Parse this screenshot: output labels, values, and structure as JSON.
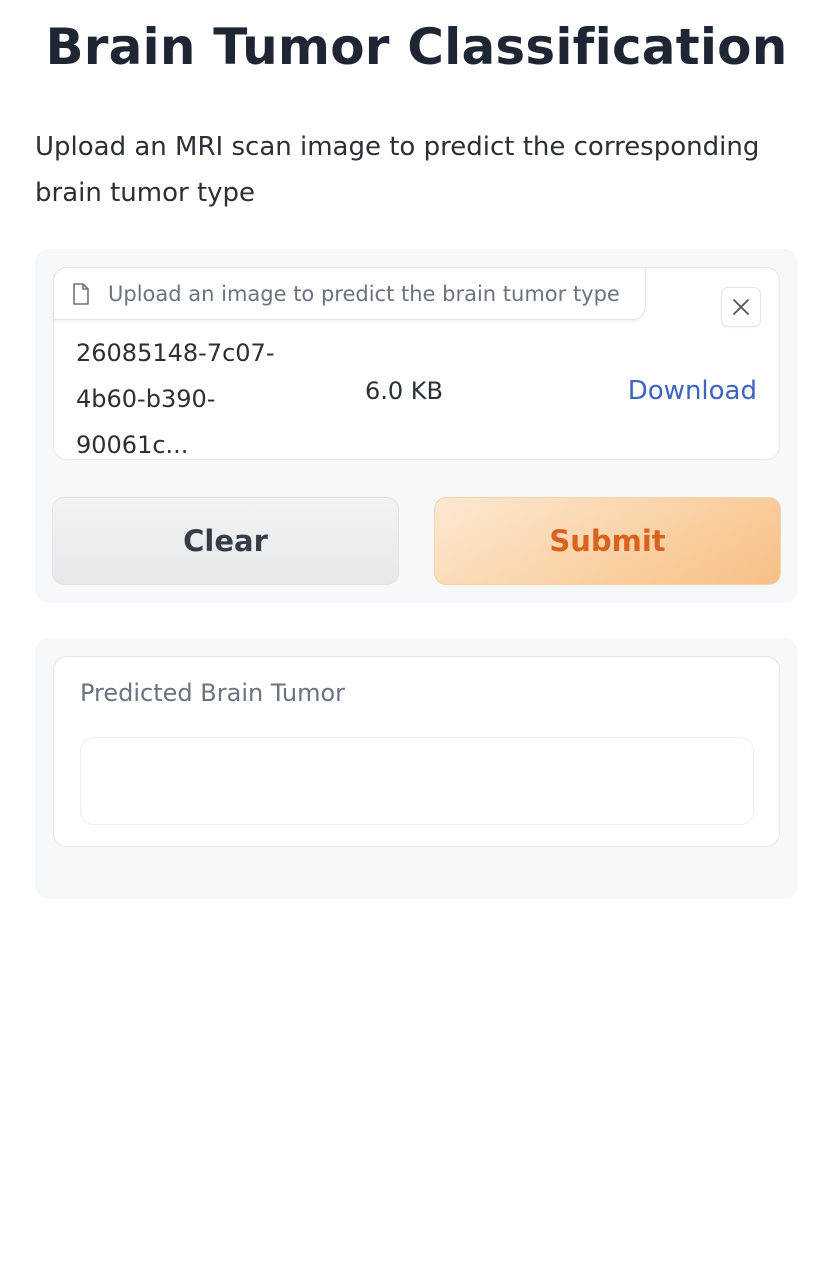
{
  "header": {
    "title": "Brain Tumor Classification",
    "description": "Upload an MRI scan image to predict the corresponding brain tumor type"
  },
  "upload": {
    "label": "Upload an image to predict the brain tumor type",
    "file": {
      "name": "26085148-7c07-4b60-b390-90061c...",
      "size": "6.0 KB",
      "download_label": "Download"
    },
    "icons": {
      "file": "file-icon",
      "close": "close-icon"
    }
  },
  "actions": {
    "clear_label": "Clear",
    "submit_label": "Submit"
  },
  "output": {
    "label": "Predicted Brain Tumor",
    "value": ""
  },
  "colors": {
    "accent": "#d8621f",
    "link": "#3f63c2",
    "panel_bg": "#f7f8fa"
  }
}
